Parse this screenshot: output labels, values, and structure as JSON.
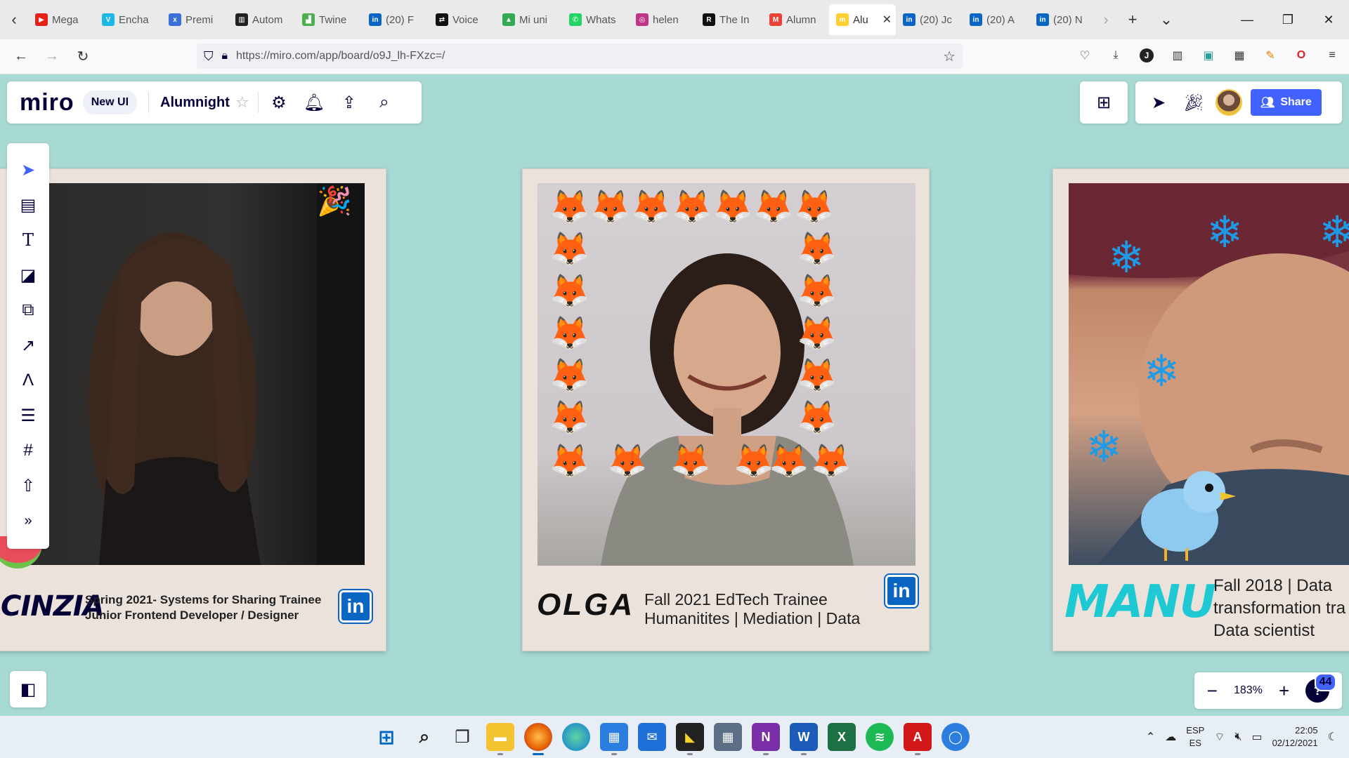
{
  "browser": {
    "tabs": [
      {
        "label": "Mega",
        "color": "#e62117",
        "glyph": "▶",
        "icon": "youtube-icon"
      },
      {
        "label": "Encha",
        "color": "#1ab7ea",
        "glyph": "V",
        "icon": "vimeo-icon"
      },
      {
        "label": "Premi",
        "color": "#3a6fd8",
        "glyph": "x",
        "icon": "premiere-icon"
      },
      {
        "label": "Autom",
        "color": "#222222",
        "glyph": "▥",
        "icon": "automation-icon"
      },
      {
        "label": "Twine",
        "color": "#4caf50",
        "glyph": "▟",
        "icon": "twine-icon"
      },
      {
        "label": "(20) F",
        "color": "#0a66c2",
        "glyph": "in",
        "icon": "linkedin-icon"
      },
      {
        "label": "Voice",
        "color": "#111111",
        "glyph": "⇄",
        "icon": "voice-icon"
      },
      {
        "label": "Mi uni",
        "color": "#34a853",
        "glyph": "▲",
        "icon": "google-drive-icon"
      },
      {
        "label": "Whats",
        "color": "#25d366",
        "glyph": "✆",
        "icon": "whatsapp-icon"
      },
      {
        "label": "helen",
        "color": "#c13584",
        "glyph": "◎",
        "icon": "instagram-icon"
      },
      {
        "label": "The In",
        "color": "#111111",
        "glyph": "R",
        "icon": "r-site-icon"
      },
      {
        "label": "Alumn",
        "color": "#ea4335",
        "glyph": "M",
        "icon": "gmail-icon"
      },
      {
        "label": "Alu",
        "color": "#ffd02f",
        "glyph": "m",
        "icon": "miro-icon",
        "active": true
      },
      {
        "label": "(20) Jc",
        "color": "#0a66c2",
        "glyph": "in",
        "icon": "linkedin-icon"
      },
      {
        "label": "(20) A",
        "color": "#0a66c2",
        "glyph": "in",
        "icon": "linkedin-icon"
      },
      {
        "label": "(20) N",
        "color": "#0a66c2",
        "glyph": "in",
        "icon": "linkedin-icon"
      }
    ],
    "url": "https://miro.com/app/board/o9J_lh-FXzc=/"
  },
  "miro": {
    "logo": "miro",
    "new_ui": "New UI",
    "board_name": "Alumnight",
    "share_label": "Share",
    "zoom": "183%",
    "help_count": "44"
  },
  "cards": {
    "cinzia": {
      "name": "CINZIA",
      "line1": "Spring 2021- Systems for Sharing Trainee",
      "line2": "Junior Frontend Developer / Designer",
      "linkedin": "in"
    },
    "olga": {
      "name": "OLGA",
      "line1": "Fall 2021 EdTech Trainee",
      "line2": "Humanitites | Mediation | Data",
      "linkedin": "in"
    },
    "manu": {
      "name": "MANU",
      "line1": "Fall 2018 | Data",
      "line2": "transformation tra",
      "line3": "Data scientist"
    }
  },
  "taskbar": {
    "lang_top": "ESP",
    "lang_bottom": "ES",
    "time": "22:05",
    "date": "02/12/2021"
  }
}
